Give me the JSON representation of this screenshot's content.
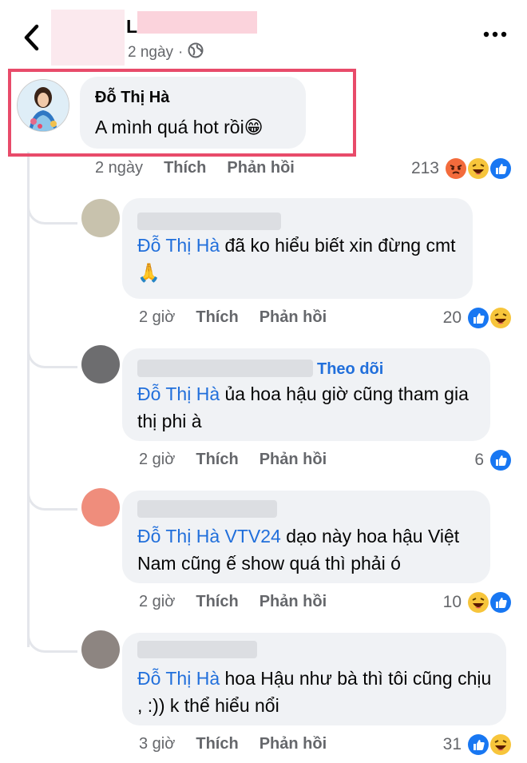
{
  "header": {
    "name": "L",
    "time": "2 ngày",
    "separator": "·"
  },
  "main_comment": {
    "author": "Đỗ Thị Hà",
    "text": "A mình quá hot rồi😁",
    "time": "2 ngày",
    "like": "Thích",
    "reply": "Phản hồi",
    "reaction_count": "213"
  },
  "replies": [
    {
      "mention": "Đỗ Thị Hà",
      "text": " đã ko hiểu biết xin đừng cmt 🙏",
      "time": "2 giờ",
      "like": "Thích",
      "reply": "Phản hồi",
      "reaction_count": "20"
    },
    {
      "follow": "Theo dõi",
      "mention": "Đỗ Thị Hà",
      "text": " ủa hoa hậu giờ cũng tham gia thị phi à",
      "time": "2 giờ",
      "like": "Thích",
      "reply": "Phản hồi",
      "reaction_count": "6"
    },
    {
      "mention": "Đỗ Thị Hà VTV24",
      "text": " dạo này hoa hậu Việt Nam cũng ế show quá thì phải ó",
      "time": "2 giờ",
      "like": "Thích",
      "reply": "Phản hồi",
      "reaction_count": "10"
    },
    {
      "mention": "Đỗ Thị Hà",
      "text": " hoa Hậu như bà thì tôi cũng chịu , :)) k thể hiểu nổi",
      "time": "3 giờ",
      "like": "Thích",
      "reply": "Phản hồi",
      "reaction_count": "31"
    }
  ],
  "colors": {
    "link": "#216fdb",
    "highlight": "#e84b6a",
    "like": "#1877f2"
  }
}
